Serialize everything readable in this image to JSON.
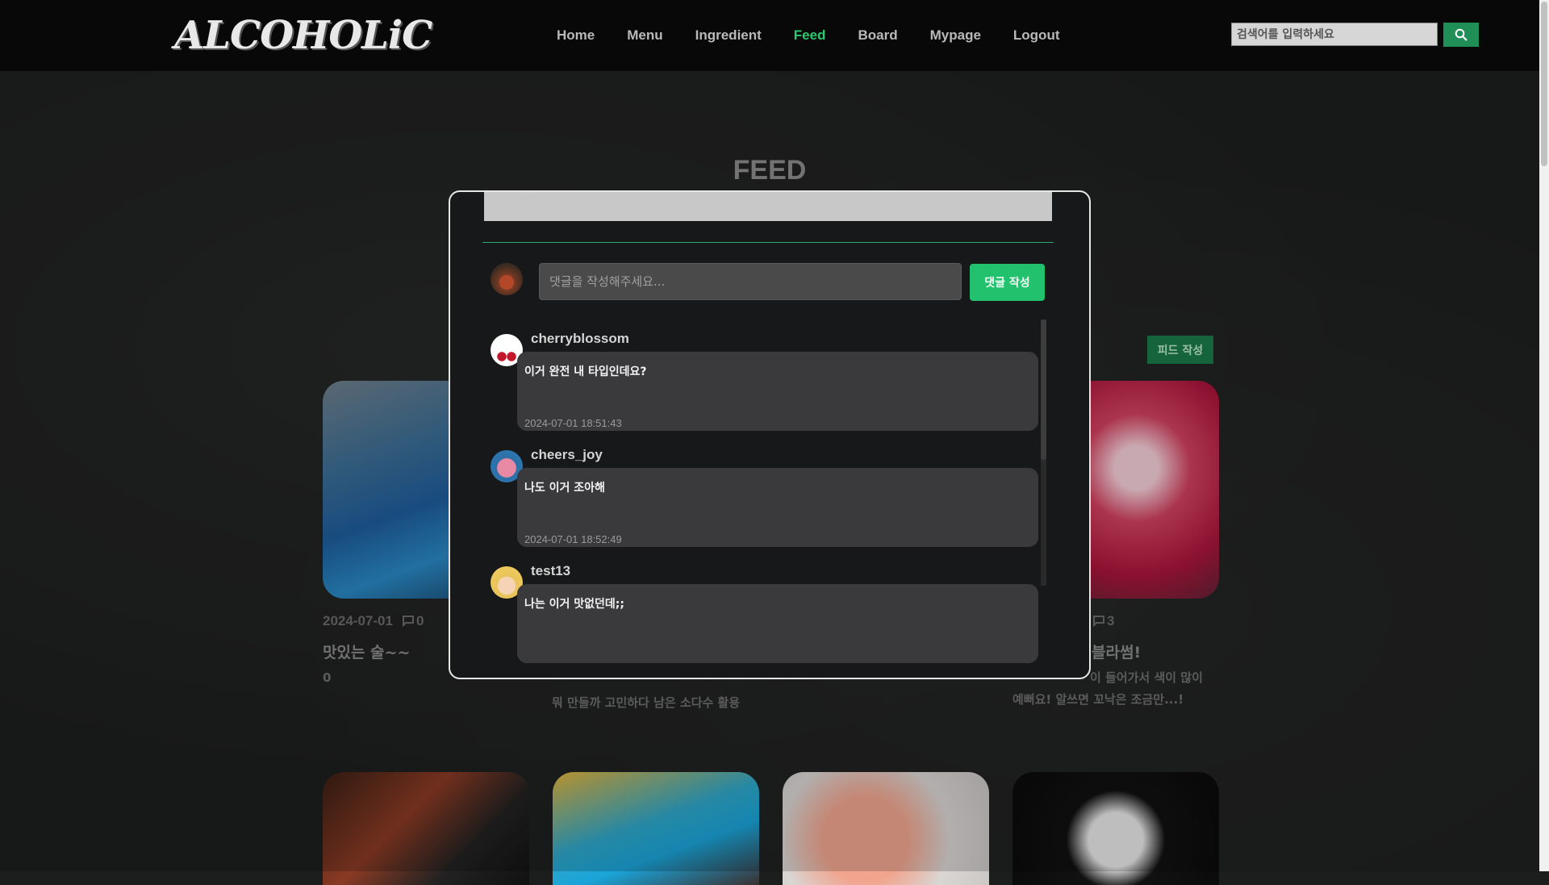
{
  "nav": {
    "logo": "ALCOHOLiC",
    "links": [
      "Home",
      "Menu",
      "Ingredient",
      "Feed",
      "Board",
      "Mypage",
      "Logout"
    ],
    "active": "Feed",
    "search_placeholder": "검색어를 입력하세요"
  },
  "page": {
    "title": "FEED",
    "write_button": "피드 작성"
  },
  "cards": [
    {
      "date": "2024-07-01",
      "comments": "0",
      "title": "맛있는 술~~",
      "desc": "0"
    },
    {
      "desc": "뭐 만들까 고민하다 남은 소다수 활용"
    },
    {
      "comments": "3",
      "title": "블라썸!",
      "desc_line1": "이 들어가서 색이 많이",
      "desc_line2": "예뻐요! 알쓰면 꼬낙은 조금만...!"
    }
  ],
  "modal": {
    "comment_placeholder": "댓글을 작성해주세요...",
    "submit_label": "댓글 작성",
    "comments": [
      {
        "user": "cherryblossom",
        "text": "이거 완전 내 타입인데요?",
        "time": "2024-07-01 18:51:43"
      },
      {
        "user": "cheers_joy",
        "text": "나도 이거 조아해",
        "time": "2024-07-01 18:52:49"
      },
      {
        "user": "test13",
        "text": "나는 이거 맛없던데;;",
        "time": ""
      }
    ]
  },
  "colors": {
    "accent_green": "#22c16e",
    "active_nav": "#2ec870",
    "modal_bg": "#171819"
  }
}
